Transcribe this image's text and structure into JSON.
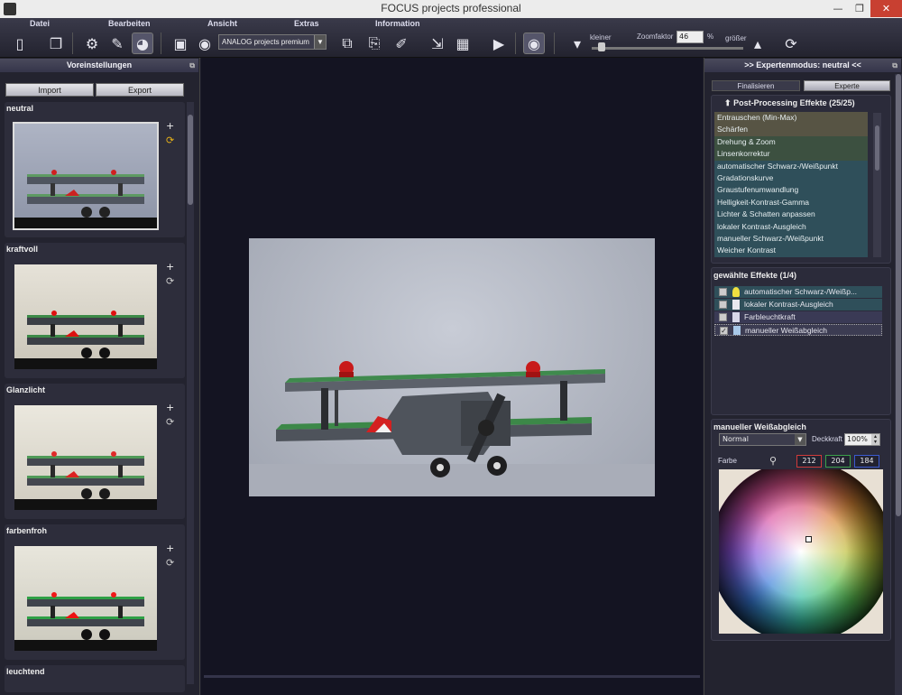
{
  "window": {
    "title": "FOCUS projects professional"
  },
  "menu": [
    "Datei",
    "Bearbeiten",
    "Ansicht",
    "Extras",
    "Information"
  ],
  "toolbar": {
    "preset_dropdown_value": "ANALOG projects premium",
    "zoom_smaller": "kleiner",
    "zoom_label": "Zoomfaktor",
    "zoom_value": "46",
    "zoom_unit": "%",
    "zoom_bigger": "größer"
  },
  "left_panel": {
    "title": "Voreinstellungen",
    "import": "Import",
    "export": "Export",
    "presets": [
      {
        "name": "neutral",
        "selected": true
      },
      {
        "name": "kraftvoll"
      },
      {
        "name": "Glanzlicht"
      },
      {
        "name": "farbenfroh"
      },
      {
        "name": "leuchtend"
      }
    ]
  },
  "right_panel": {
    "title": ">> Expertenmodus: neutral <<",
    "tab_finalize": "Finalisieren",
    "tab_expert": "Experte",
    "post_processing_title": "Post-Processing Effekte (25/25)",
    "post_processing_items": [
      "Entrauschen (Min-Max)",
      "Schärfen",
      "Drehung & Zoom",
      "Linsenkorrektur",
      "automatischer Schwarz-/Weißpunkt",
      "Gradationskurve",
      "Graustufenumwandlung",
      "Helligkeit-Kontrast-Gamma",
      "Lichter & Schatten anpassen",
      "lokaler Kontrast-Ausgleich",
      "manueller Schwarz-/Weißpunkt",
      "Weicher Kontrast"
    ],
    "chosen_title": "gewählte Effekte (1/4)",
    "chosen_items": [
      {
        "label": "automatischer Schwarz-/Weißp...",
        "checked": false,
        "icon": "lightbulb-icon"
      },
      {
        "label": "lokaler Kontrast-Ausgleich",
        "checked": false,
        "icon": "page-icon"
      },
      {
        "label": "Farbleuchtkraft",
        "checked": false,
        "icon": "page-icon"
      },
      {
        "label": "manueller Weißabgleich",
        "checked": true,
        "icon": "page-icon"
      }
    ],
    "wb_title": "manueller Weißabgleich",
    "blend_mode": "Normal",
    "opacity_label": "Deckkraft",
    "opacity_value": "100%",
    "color_label": "Farbe",
    "r": "212",
    "g": "204",
    "b": "184"
  }
}
